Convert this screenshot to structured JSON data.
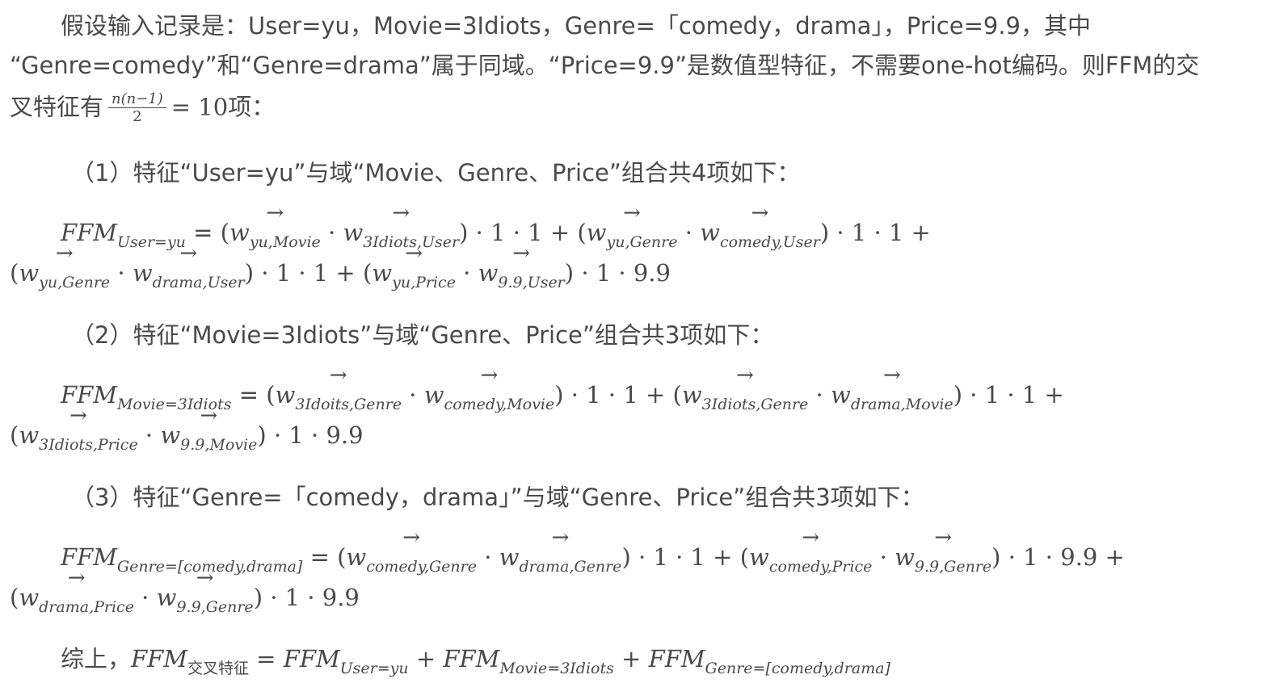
{
  "intro": {
    "line1": "假设输入记录是：User=yu，Movie=3Idiots，Genre=「comedy，drama」，Price=9.9，其中",
    "line2": "“Genre=comedy”和“Genre=drama”属于同域。“Price=9.9”是数值型特征，不需要one-hot编码。则FFM的交",
    "line3_prefix": "叉特征有",
    "frac_num": "n(n−1)",
    "frac_den": "2",
    "line3_suffix_math": "= 10",
    "line3_suffix_text": "项："
  },
  "sec1": {
    "heading": "（1）特征“User=yu”与域“Movie、Genre、Price”组合共4项如下：",
    "lhs": "FFM",
    "lhs_sub": "User=yu",
    "t1a": "w",
    "t1a_sub": "yu,Movie",
    "t1b": "w",
    "t1b_sub": "3Idiots,User",
    "t1_tail": ") · 1 · 1 + (",
    "t2a": "w",
    "t2a_sub": "yu,Genre",
    "t2b": "w",
    "t2b_sub": "comedy,User",
    "t2_tail": ") · 1 · 1  +",
    "t3a": "w",
    "t3a_sub": "yu,Genre",
    "t3b": "w",
    "t3b_sub": "drama,User",
    "t3_tail": ") · 1 · 1 + (",
    "t4a": "w",
    "t4a_sub": "yu,Price",
    "t4b": "w",
    "t4b_sub": "9.9,User",
    "t4_tail": ") · 1 · 9.9"
  },
  "sec2": {
    "heading": "（2）特征“Movie=3Idiots”与域“Genre、Price”组合共3项如下：",
    "lhs": "FFM",
    "lhs_sub": "Movie=3Idiots",
    "t1a": "w",
    "t1a_sub": "3Idoits,Genre",
    "t1b": "w",
    "t1b_sub": "comedy,Movie",
    "t1_tail": ") · 1 · 1  + (",
    "t2a": "w",
    "t2a_sub": "3Idiots,Genre",
    "t2b": "w",
    "t2b_sub": "drama,Movie",
    "t2_tail": ") · 1 · 1 +",
    "t3a": "w",
    "t3a_sub": "3Idiots,Price",
    "t3b": "w",
    "t3b_sub": "9.9,Movie",
    "t3_tail": ") · 1 · 9.9"
  },
  "sec3": {
    "heading": "（3）特征“Genre=「comedy，drama」”与域“Genre、Price”组合共3项如下：",
    "lhs": "FFM",
    "lhs_sub": "Genre=[comedy,drama]",
    "t1a": "w",
    "t1a_sub": "comedy,Genre",
    "t1b": "w",
    "t1b_sub": "drama,Genre",
    "t1_tail": ") · 1 · 1  + (",
    "t2a": "w",
    "t2a_sub": "comedy,Price",
    "t2b": "w",
    "t2b_sub": "9.9,Genre",
    "t2_tail": ") · 1 · 9.9 +",
    "t3a": "w",
    "t3a_sub": "drama,Price",
    "t3b": "w",
    "t3b_sub": "9.9,Genre",
    "t3_tail": ") · 1 · 9.9"
  },
  "summary": {
    "prefix": "综上，",
    "lhs": "FFM",
    "lhs_sub": "交叉特征",
    "eq": " = ",
    "a": "FFM",
    "a_sub": "User=yu",
    "plus1": " + ",
    "b": "FFM",
    "b_sub": "Movie=3Idiots",
    "plus2": " + ",
    "c": "FFM",
    "c_sub": "Genre=[comedy,drama]"
  }
}
